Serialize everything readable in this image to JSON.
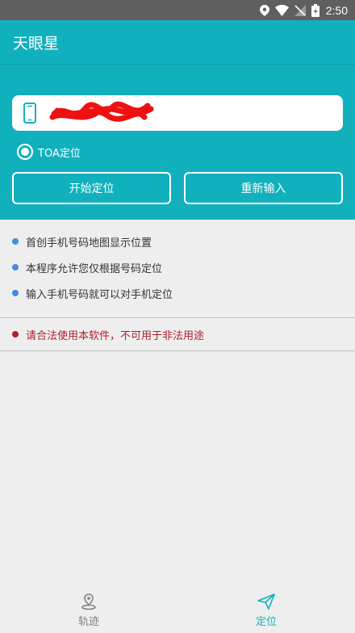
{
  "status_bar": {
    "time": "2:50"
  },
  "app": {
    "title": "天眼星"
  },
  "search": {
    "phone_value": ""
  },
  "options": {
    "radio_label": "TOA定位",
    "radio_selected": true
  },
  "buttons": {
    "start_label": "开始定位",
    "reenter_label": "重新输入"
  },
  "info": {
    "items": [
      "首创手机号码地图显示位置",
      "本程序允许您仅根据号码定位",
      "输入手机号码就可以对手机定位"
    ],
    "warning": "请合法使用本软件，不可用于非法用途"
  },
  "nav": {
    "tabs": [
      {
        "label": "轨迹",
        "icon": "map-pin-icon",
        "active": false
      },
      {
        "label": "定位",
        "icon": "send-icon",
        "active": true
      }
    ]
  },
  "colors": {
    "primary": "#11b0bd",
    "bullet": "#3f8de0",
    "warning": "#b01e2a",
    "redaction": "#ee1111"
  }
}
